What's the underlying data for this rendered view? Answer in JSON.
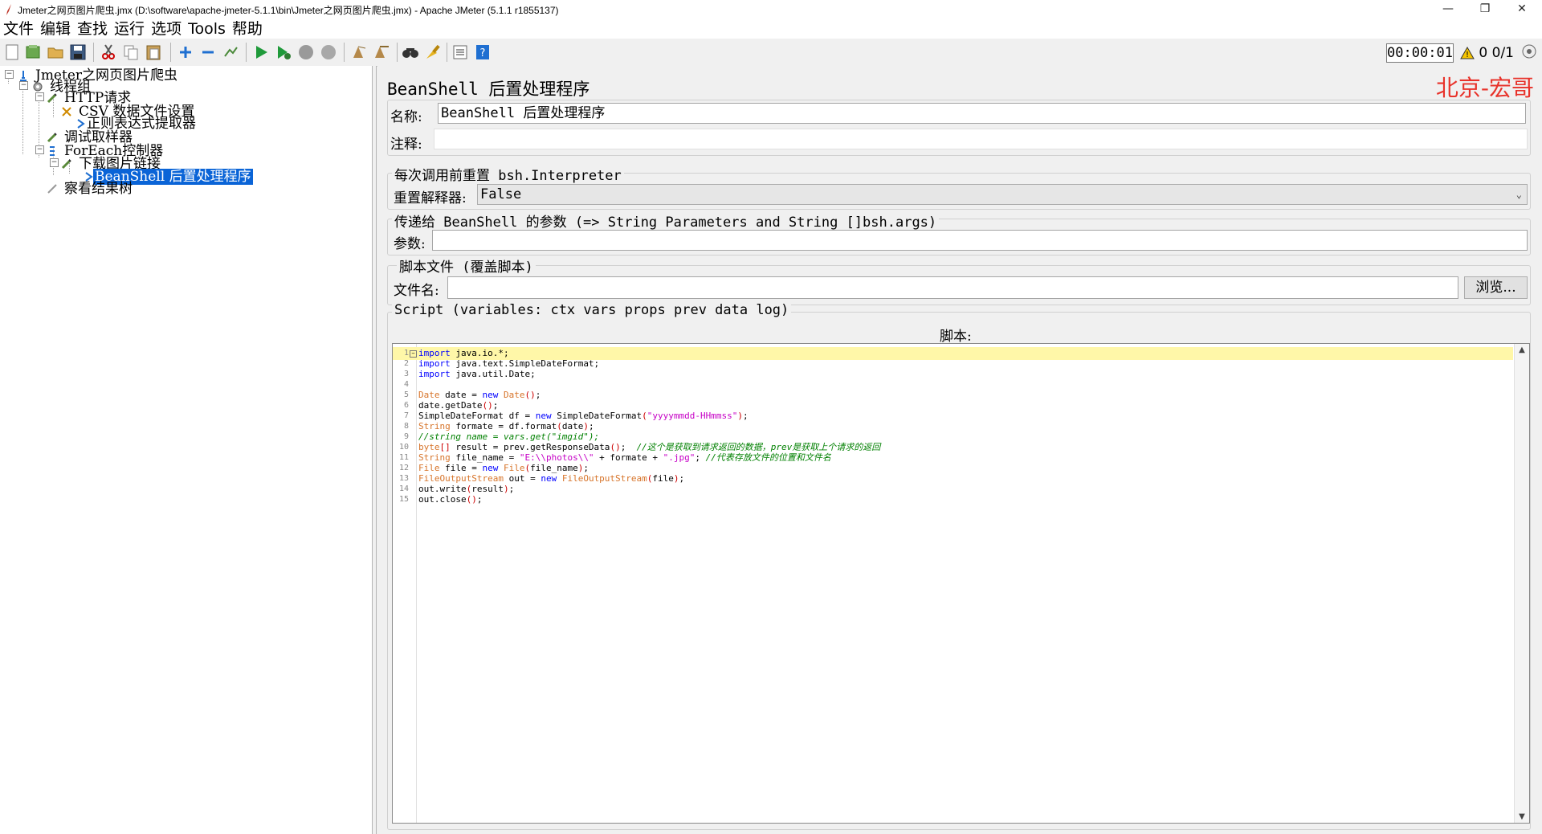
{
  "window": {
    "title": "Jmeter之网页图片爬虫.jmx (D:\\software\\apache-jmeter-5.1.1\\bin\\Jmeter之网页图片爬虫.jmx) - Apache JMeter (5.1.1 r1855137)",
    "minimize": "—",
    "restore": "❐",
    "close": "✕"
  },
  "menu": [
    "文件",
    "编辑",
    "查找",
    "运行",
    "选项",
    "Tools",
    "帮助"
  ],
  "toolbar": {
    "timer": "00:00:01",
    "warning_count": "0",
    "threads": "0/1"
  },
  "tree": {
    "items": [
      {
        "label": "Jmeter之网页图片爬虫",
        "icon": "testplan-icon"
      },
      {
        "label": "线程组",
        "icon": "gear-icon"
      },
      {
        "label": "HTTP请求",
        "icon": "pipette-icon"
      },
      {
        "label": "CSV 数据文件设置",
        "icon": "scissors-icon"
      },
      {
        "label": "正则表达式提取器",
        "icon": "arrow-right-icon"
      },
      {
        "label": "调试取样器",
        "icon": "pipette-icon"
      },
      {
        "label": "ForEach控制器",
        "icon": "controller-icon"
      },
      {
        "label": "下载图片链接",
        "icon": "pipette-icon"
      },
      {
        "label": "BeanShell 后置处理程序",
        "icon": "arrow-right-icon"
      },
      {
        "label": "察看结果树",
        "icon": "listener-icon"
      }
    ]
  },
  "panel": {
    "title": "BeanShell 后置处理程序",
    "brand": "北京-宏哥",
    "name_label": "名称:",
    "name_value": "BeanShell 后置处理程序",
    "comment_label": "注释:",
    "comment_value": "",
    "reset_group_title": "每次调用前重置 bsh.Interpreter",
    "reset_label": "重置解释器:",
    "reset_value": "False",
    "params_group_title": "传递给 BeanShell 的参数 (=> String Parameters and String []bsh.args)",
    "params_label": "参数:",
    "params_value": "",
    "file_group_title": "脚本文件 (覆盖脚本)",
    "file_label": "文件名:",
    "file_value": "",
    "browse_button": "浏览...",
    "script_group_title": "Script (variables: ctx vars props prev data log)",
    "script_label": "脚本:"
  },
  "script": {
    "lines": [
      "import java.io.*;",
      "import java.text.SimpleDateFormat;",
      "import java.util.Date;",
      "",
      "Date date = new Date();",
      "date.getDate();",
      "SimpleDateFormat df = new SimpleDateFormat(\"yyyymmdd-HHmmss\");",
      "String formate = df.format(date);",
      "//string name = vars.get(\"imgid\");",
      "byte[] result = prev.getResponseData();  //这个是获取到请求返回的数据，prev是获取上个请求的返回",
      "String file_name = \"E:\\\\photos\\\\\" + formate + \".jpg\"; //代表存放文件的位置和文件名",
      "File file = new File(file_name);",
      "FileOutputStream out = new FileOutputStream(file);",
      "out.write(result);",
      "out.close();"
    ]
  }
}
